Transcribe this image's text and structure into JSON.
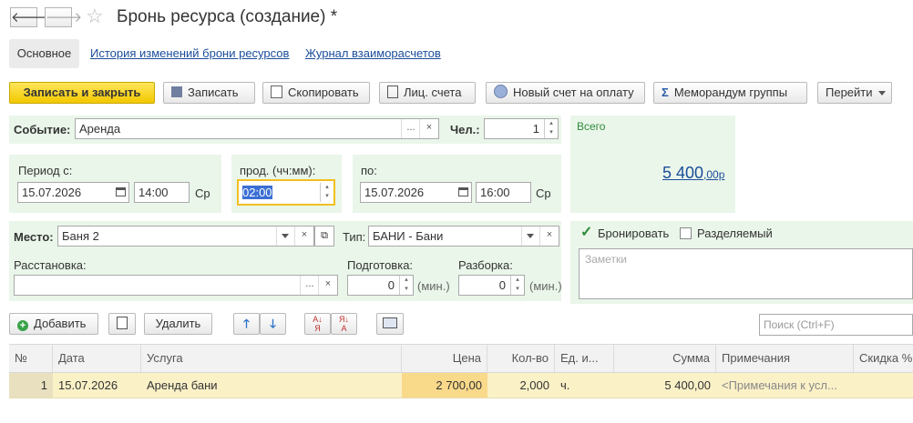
{
  "header": {
    "title": "Бронь ресурса (создание) *"
  },
  "tabs": [
    {
      "label": "Основное"
    },
    {
      "label": "История изменений брони ресурсов"
    },
    {
      "label": "Журнал взаиморасчетов"
    }
  ],
  "toolbar": {
    "save_close": "Записать и закрыть",
    "save": "Записать",
    "copy": "Скопировать",
    "accounts": "Лиц. счета",
    "new_invoice": "Новый счет на оплату",
    "memo": "Меморандум группы",
    "goto": "Перейти"
  },
  "form": {
    "event_label": "Событие:",
    "event_value": "Аренда",
    "people_label": "Чел.:",
    "people_value": "1",
    "period_from_label": "Период с:",
    "date_from": "15.07.2026",
    "time_from": "14:00",
    "day_from": "Ср",
    "duration_label": "прод. (чч:мм):",
    "duration": "02:00",
    "to_label": "по:",
    "date_to": "15.07.2026",
    "time_to": "16:00",
    "day_to": "Ср",
    "place_label": "Место:",
    "place_value": "Баня 2",
    "type_label": "Тип:",
    "type_value": "БАНИ - Бани",
    "arrangement_label": "Расстановка:",
    "arrangement_value": "",
    "prep_label": "Подготовка:",
    "prep_value": "0",
    "prep_unit": "(мин.)",
    "teardown_label": "Разборка:",
    "teardown_value": "0",
    "teardown_unit": "(мин.)"
  },
  "total": {
    "label": "Всего",
    "amount": "5 400",
    "cents": ",00р"
  },
  "options": {
    "book_label": "Бронировать",
    "book_checked": true,
    "shared_label": "Разделяемый",
    "shared_checked": false,
    "notes_placeholder": "Заметки"
  },
  "table_toolbar": {
    "add": "Добавить",
    "delete": "Удалить",
    "search_placeholder": "Поиск (Ctrl+F)"
  },
  "table": {
    "columns": [
      "№",
      "Дата",
      "Услуга",
      "Цена",
      "Кол-во",
      "Ед. и...",
      "Сумма",
      "Примечания",
      "Скидка %"
    ],
    "rows": [
      {
        "n": "1",
        "date": "15.07.2026",
        "service": "Аренда бани",
        "price": "2 700,00",
        "qty": "2,000",
        "unit": "ч.",
        "sum": "5 400,00",
        "note": "<Примечания к усл...",
        "discount": ""
      }
    ]
  }
}
